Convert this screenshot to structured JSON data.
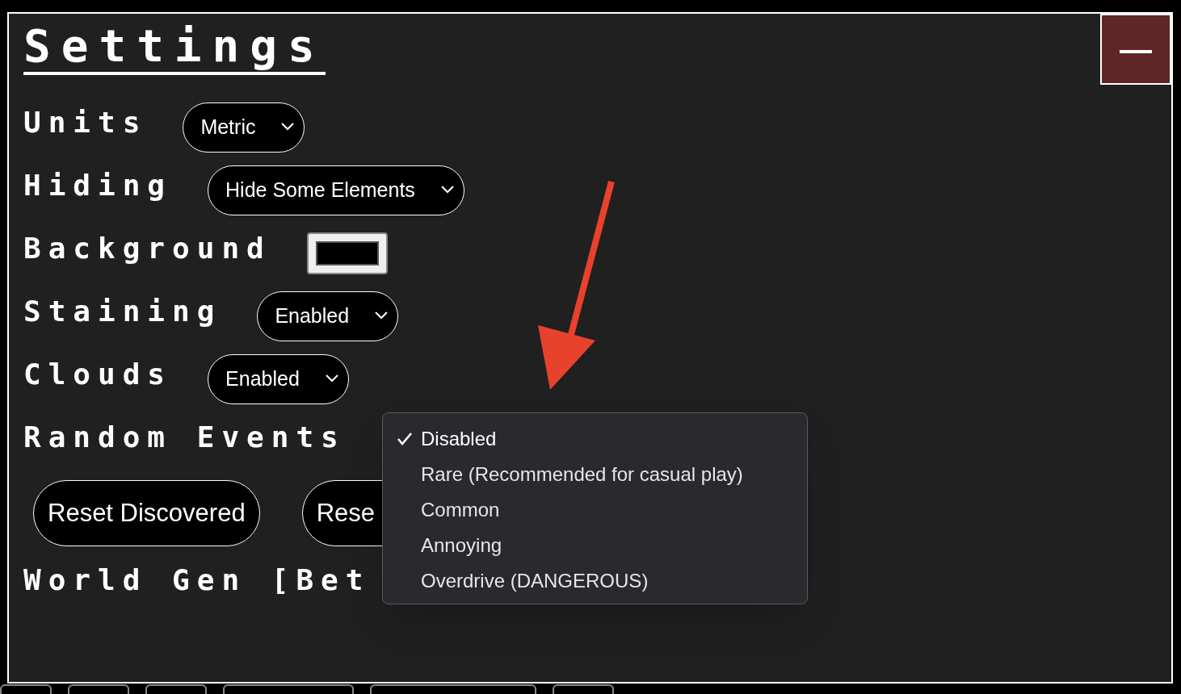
{
  "title": "Settings",
  "settings": [
    {
      "kind": "select",
      "label": "Units",
      "value": "Metric"
    },
    {
      "kind": "select",
      "label": "Hiding",
      "value": "Hide Some Elements"
    },
    {
      "kind": "color",
      "label": "Background",
      "color": "#000000"
    },
    {
      "kind": "select",
      "label": "Staining",
      "value": "Enabled"
    },
    {
      "kind": "select",
      "label": "Clouds",
      "value": "Enabled"
    },
    {
      "kind": "open-select",
      "label": "Random Events"
    }
  ],
  "buttons": [
    "Reset Discovered",
    "Rese"
  ],
  "world_gen_label": "World Gen [Bet",
  "minimize_button": "—",
  "menu": [
    {
      "label": "Disabled",
      "selected": true
    },
    {
      "label": "Rare (Recommended for casual play)",
      "selected": false
    },
    {
      "label": "Common",
      "selected": false
    },
    {
      "label": "Annoying",
      "selected": false
    },
    {
      "label": "Overdrive (DANGEROUS)",
      "selected": false
    }
  ]
}
